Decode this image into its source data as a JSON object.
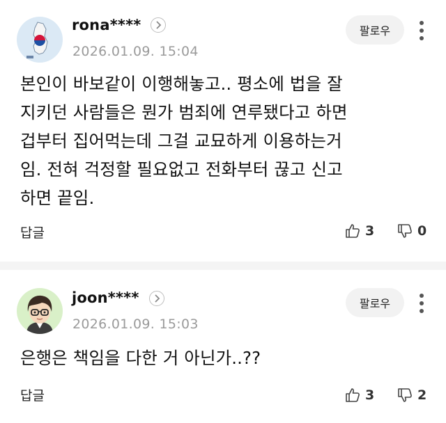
{
  "comments": [
    {
      "username": "rona****",
      "timestamp": "2026.01.09. 15:04",
      "follow_label": "팔로우",
      "body_lines": [
        "본인이 바보같이 이행해놓고.. 평소에 법을 잘",
        "지키던 사람들은 뭔가 범죄에 연루됐다고 하면",
        "겁부터 집어먹는데 그걸 교묘하게 이용하는거",
        "임. 전혀 걱정할 필요없고 전화부터 끊고 신고",
        "하면 끝임."
      ],
      "reply_label": "답글",
      "likes": "3",
      "dislikes": "0",
      "avatar_icon": "korea-map-icon"
    },
    {
      "username": "joon****",
      "timestamp": "2026.01.09. 15:03",
      "follow_label": "팔로우",
      "body_lines": [
        "은행은 책임을 다한 거 아닌가..??"
      ],
      "reply_label": "답글",
      "likes": "3",
      "dislikes": "2",
      "avatar_icon": "cartoon-person-glasses-icon"
    }
  ],
  "colors": {
    "meta_gray": "#9a9a9a",
    "button_bg": "#f2f2f2",
    "divider": "#f4f4f4"
  }
}
